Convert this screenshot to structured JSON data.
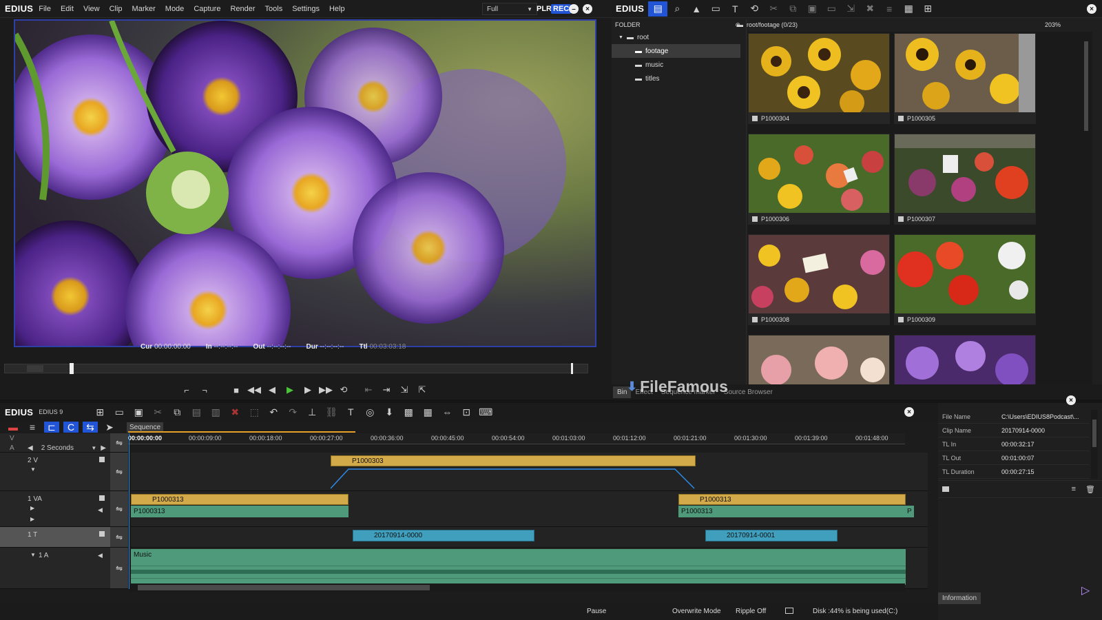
{
  "player": {
    "logo": "EDIUS",
    "menu": [
      "File",
      "Edit",
      "View",
      "Clip",
      "Marker",
      "Mode",
      "Capture",
      "Render",
      "Tools",
      "Settings",
      "Help"
    ],
    "quality": "Full",
    "plr": "PLR",
    "rec": "REC",
    "cur_label": "Cur",
    "cur_value": "00:00:00:00",
    "in_label": "In",
    "in_value": "--:--:--:--",
    "out_label": "Out",
    "out_value": "--:--:--:--",
    "dur_label": "Dur",
    "dur_value": "--:--:--:--",
    "ttl_label": "Ttl",
    "ttl_value": "00:03:03:18"
  },
  "bin": {
    "logo": "EDIUS",
    "folder_header": "FOLDER",
    "path": "root/footage (0/23)",
    "zoom": "203%",
    "folders": [
      {
        "name": "root",
        "level": 0
      },
      {
        "name": "footage",
        "level": 1
      },
      {
        "name": "music",
        "level": 1
      },
      {
        "name": "titles",
        "level": 1
      }
    ],
    "clips": [
      {
        "name": "P1000304"
      },
      {
        "name": "P1000305"
      },
      {
        "name": "P1000306"
      },
      {
        "name": "P1000307"
      },
      {
        "name": "P1000308"
      },
      {
        "name": "P1000309"
      },
      {
        "name": ""
      },
      {
        "name": ""
      }
    ],
    "footer_tabs": [
      "Bin",
      "Effect",
      "Sequence marker",
      "Source Browser"
    ],
    "watermark": "FileFamous"
  },
  "timeline": {
    "logo": "EDIUS",
    "version": "EDIUS 9",
    "sequence_tab": "Sequence",
    "scale": "2 Seconds",
    "ruler": [
      "00:00:00:00",
      "00:00:09:00",
      "00:00:18:00",
      "00:00:27:00",
      "00:00:36:00",
      "00:00:45:00",
      "00:00:54:00",
      "00:01:03:00",
      "00:01:12:00",
      "00:01:21:00",
      "00:01:30:00",
      "00:01:39:00",
      "00:01:48:00"
    ],
    "tracks": {
      "v_label": "V",
      "a_label": "A",
      "track2v": "2 V",
      "track1va": "1 VA",
      "track1t": "1 T",
      "track1a": "1 A"
    },
    "clips": {
      "v2_clip": "P1000303",
      "va_clip1": "P1000313",
      "va_audio1": "P1000313",
      "va_clip2": "P1000313",
      "va_audio2": "P1000313",
      "va_audio_tail": "P",
      "title1": "20170914-0000",
      "title2": "20170914-0001",
      "music": "Music"
    }
  },
  "info": {
    "rows": [
      {
        "key": "File Name",
        "value": "C:\\Users\\EDIUS8Podcast\\..."
      },
      {
        "key": "Clip Name",
        "value": "20170914-0000"
      },
      {
        "key": "TL In",
        "value": "00:00:32:17"
      },
      {
        "key": "TL Out",
        "value": "00:01:00:07"
      },
      {
        "key": "TL Duration",
        "value": "00:00:27:15"
      }
    ],
    "tab": "Information"
  },
  "status": {
    "pause": "Pause",
    "mode": "Overwrite Mode",
    "ripple": "Ripple Off",
    "disk": "Disk :44% is being used(C:)"
  },
  "colors": {
    "accent_blue": "#2e3fa8",
    "video_clip": "#d2aa4a",
    "audio_clip": "#4f9a7b",
    "title_clip": "#3f9fbd"
  }
}
